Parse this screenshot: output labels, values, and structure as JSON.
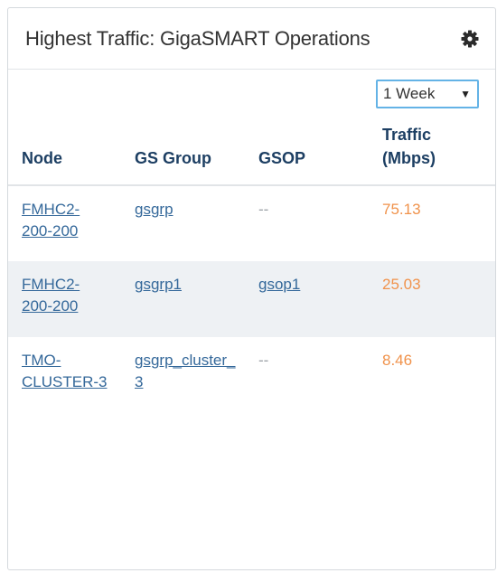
{
  "widget": {
    "title": "Highest Traffic: GigaSMART Operations",
    "settings_icon": "gear-icon"
  },
  "range_select": {
    "selected": "1 Week",
    "arrow": "▼"
  },
  "table": {
    "headers": {
      "node": "Node",
      "gs_group": "GS Group",
      "gsop": "GSOP",
      "traffic_line1": "Traffic",
      "traffic_line2": "(Mbps)"
    },
    "rows": [
      {
        "node": "FMHC2-200-200",
        "gs_group": "gsgrp",
        "gsop": "--",
        "traffic": "75.13"
      },
      {
        "node": "FMHC2-200-200",
        "gs_group": "gsgrp1",
        "gsop": "gsop1",
        "traffic": "25.03"
      },
      {
        "node": "TMO-CLUSTER-3",
        "gs_group": "gsgrp_cluster_3",
        "gsop": "--",
        "traffic": "8.46"
      }
    ]
  },
  "colors": {
    "header_text": "#1d3f63",
    "link": "#34689a",
    "traffic": "#f0924b",
    "alt_row": "#eef1f4",
    "select_border": "#64b3e6"
  }
}
